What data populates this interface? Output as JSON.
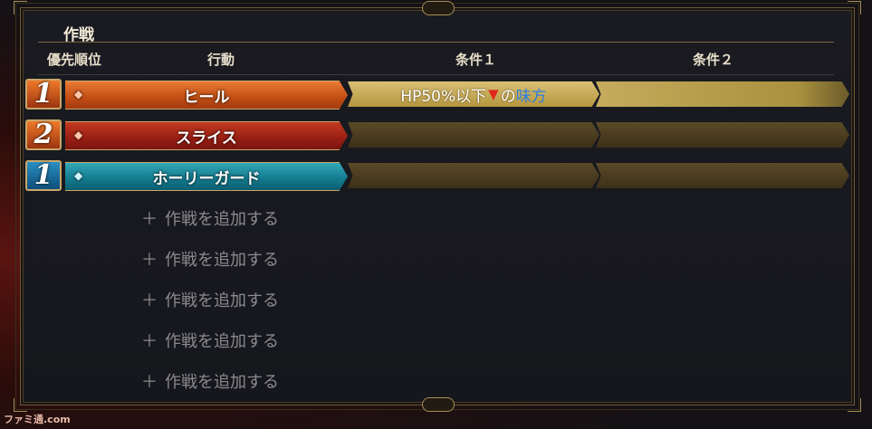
{
  "title": "作戦",
  "headers": {
    "priority": "優先順位",
    "action": "行動",
    "condition1": "条件１",
    "condition2": "条件２"
  },
  "rows": [
    {
      "rank": "1",
      "rank_color": "#e0651f",
      "action": "ヒール",
      "action_color": "#d05a1a",
      "gem": "orange",
      "condition1": {
        "prefix": "HP50%以下",
        "symbol": "▼",
        "mid": "の",
        "target": "味方"
      },
      "condition2": ""
    },
    {
      "rank": "2",
      "rank_color": "#e0651f",
      "action": "スライス",
      "action_color": "#a82818",
      "gem": "orange",
      "condition1": {
        "prefix": "",
        "symbol": "",
        "mid": "",
        "target": ""
      },
      "condition2": ""
    },
    {
      "rank": "1",
      "rank_color": "#1c7fb8",
      "action": "ホーリーガード",
      "action_color": "#1a8fa3",
      "gem": "teal",
      "condition1": {
        "prefix": "",
        "symbol": "",
        "mid": "",
        "target": ""
      },
      "condition2": ""
    }
  ],
  "add_slots": [
    "作戦を追加する",
    "作戦を追加する",
    "作戦を追加する",
    "作戦を追加する",
    "作戦を追加する"
  ],
  "logo": "ファミ通.com"
}
